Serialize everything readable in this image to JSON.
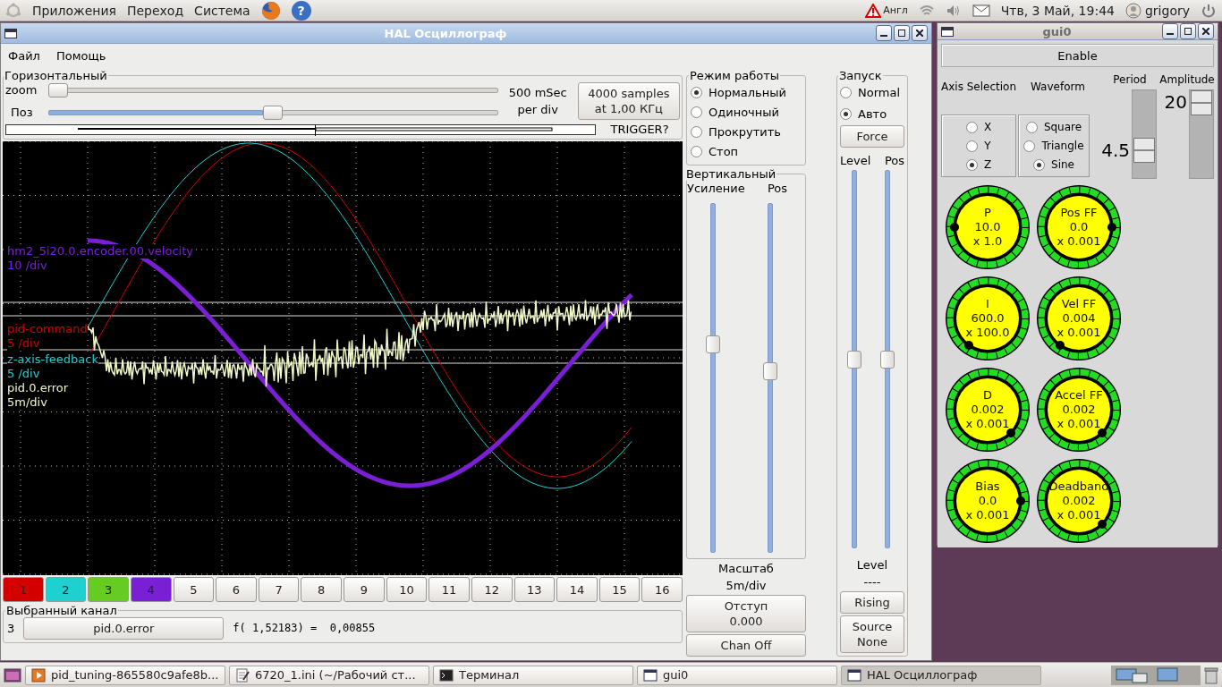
{
  "top_panel": {
    "menus": [
      "Приложения",
      "Переход",
      "Система"
    ],
    "help_glyph": "?",
    "keyboard": "Англ",
    "clock": "Чтв, 3 Май, 19:44",
    "user": "grigory"
  },
  "scope": {
    "title": "HAL Осциллограф",
    "menu": [
      "Файл",
      "Помощь"
    ],
    "horizontal": {
      "title": "Горизонтальный",
      "sliders": [
        {
          "label": "zoom",
          "level": 0.0
        },
        {
          "label": "Поз",
          "level": 0.5
        }
      ],
      "rate": [
        "500 mSec",
        "per div"
      ],
      "samples_button": [
        "4000 samples",
        "at 1,00 КГц"
      ],
      "trigger_label": "TRIGGER?"
    },
    "traces": [
      {
        "name": "hm2_5i20.0.encoder.00.velocity",
        "scale": "10 /div",
        "color": "#7a1fd6"
      },
      {
        "name": "pid-command",
        "scale": "5 /div",
        "color": "#d40000"
      },
      {
        "name": "z-axis-feedback",
        "scale": "5 /div",
        "color": "#1ed0d0"
      },
      {
        "name": "pid.0.error",
        "scale": "5m/div",
        "color": "#f0f8c8"
      }
    ],
    "channels": [
      {
        "label": "1",
        "color": "#d40000"
      },
      {
        "label": "2",
        "color": "#1ed0d0"
      },
      {
        "label": "3",
        "color": "#66cc22"
      },
      {
        "label": "4",
        "color": "#7a1fd6"
      },
      {
        "label": "5"
      },
      {
        "label": "6"
      },
      {
        "label": "7"
      },
      {
        "label": "8"
      },
      {
        "label": "9"
      },
      {
        "label": "10"
      },
      {
        "label": "11"
      },
      {
        "label": "12"
      },
      {
        "label": "13"
      },
      {
        "label": "14"
      },
      {
        "label": "15"
      },
      {
        "label": "16"
      }
    ],
    "selected_channel": {
      "title": "Выбранный канал",
      "number": "3",
      "name": "pid.0.error",
      "readout": "f( 1,52183) =  0,00855"
    },
    "mode": {
      "title": "Режим работы",
      "options": [
        {
          "label": "Нормальный",
          "selected": true
        },
        {
          "label": "Одиночный",
          "selected": false
        },
        {
          "label": "Прокрутить",
          "selected": false
        },
        {
          "label": "Стоп",
          "selected": false
        }
      ]
    },
    "vertical": {
      "title": "Вертикальный",
      "sliders": [
        {
          "label": "Усиление",
          "level": 0.6
        },
        {
          "label": "Pos",
          "level": 0.52
        }
      ],
      "scale_title": "Масштаб",
      "scale": "5m/div",
      "offset_button": [
        "Отступ",
        "0.000"
      ],
      "chan_off": "Chan Off"
    },
    "trigger": {
      "title": "Запуск",
      "options": [
        {
          "label": "Normal",
          "selected": false
        },
        {
          "label": "Авто",
          "selected": true
        }
      ],
      "force": "Force",
      "sliders": [
        {
          "label": "Level",
          "level": 0.5
        },
        {
          "label": "Pos",
          "level": 0.5
        }
      ],
      "level_title": "Level",
      "level_value": "----",
      "edge_button": "Rising",
      "source_button": [
        "Source",
        "None"
      ]
    }
  },
  "gui0": {
    "title": "gui0",
    "enable": "Enable",
    "axis_title": "Axis Selection",
    "waveform_title": "Waveform",
    "axes": [
      {
        "label": "X",
        "selected": false
      },
      {
        "label": "Y",
        "selected": false
      },
      {
        "label": "Z",
        "selected": true
      }
    ],
    "waveforms": [
      {
        "label": "Square",
        "selected": false
      },
      {
        "label": "Triangle",
        "selected": false
      },
      {
        "label": "Sine",
        "selected": true
      }
    ],
    "period": {
      "label": "Period",
      "value": "4.5",
      "level": 0.25
    },
    "amplitude": {
      "label": "Amplitude",
      "value": "20",
      "level": 1
    },
    "knobs": [
      {
        "label": "P",
        "value": "10.0",
        "scale": "x 1.0",
        "kind": "west"
      },
      {
        "label": "Pos FF",
        "value": "0.0",
        "scale": "x 0.001",
        "kind": "east"
      },
      {
        "label": "I",
        "value": "600.0",
        "scale": "x 100.0",
        "kind": "southwest"
      },
      {
        "label": "Vel FF",
        "value": "0.004",
        "scale": "x 0.001",
        "kind": "southwest"
      },
      {
        "label": "D",
        "value": "0.002",
        "scale": "x 0.001",
        "kind": "southeast"
      },
      {
        "label": "Accel FF",
        "value": "0.002",
        "scale": "x 0.001",
        "kind": "southeast"
      },
      {
        "label": "Bias",
        "value": "0.0",
        "scale": "x 0.001",
        "kind": "east"
      },
      {
        "label": "Deadband",
        "value": "0.002",
        "scale": "x 0.001",
        "kind": "southeast"
      }
    ]
  },
  "taskbar": {
    "tasks": [
      {
        "label": "pid_tuning-865580c9afe8b...",
        "kind": "media",
        "selected": false
      },
      {
        "label": "6720_1.ini (~/Рабочий ст...",
        "kind": "editor",
        "selected": false
      },
      {
        "label": "Терминал",
        "kind": "terminal",
        "selected": false
      },
      {
        "label": "gui0",
        "kind": "window",
        "selected": false
      },
      {
        "label": "HAL Осциллограф",
        "kind": "window",
        "selected": true
      }
    ]
  }
}
